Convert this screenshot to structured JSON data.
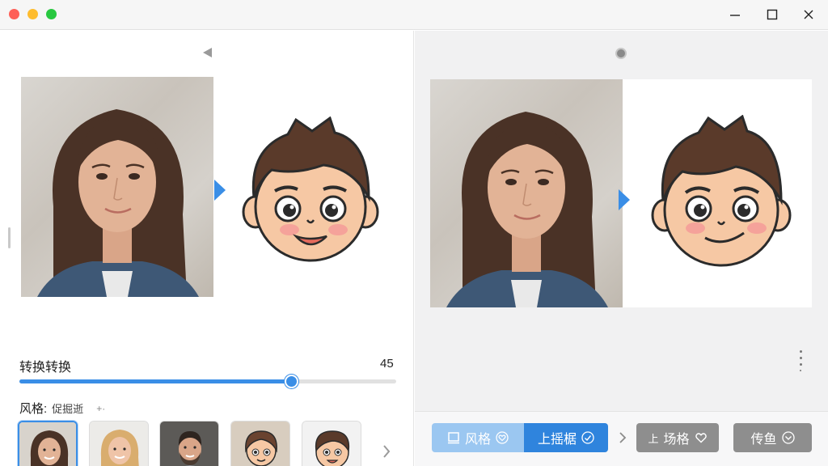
{
  "window": {
    "controls": [
      "traffic-close",
      "traffic-minimize",
      "traffic-zoom",
      "minimize",
      "maximize",
      "close"
    ]
  },
  "left_panel": {
    "slider": {
      "label": "转换转换",
      "value": "45",
      "value_fraction": 0.72
    },
    "style": {
      "label": "风格:",
      "hint": "促掘逝",
      "add_icon": "+·"
    },
    "thumbnails": [
      {
        "name": "portrait-woman-dark-hair",
        "selected": true
      },
      {
        "name": "portrait-woman-blonde",
        "selected": false
      },
      {
        "name": "portrait-man-beard",
        "selected": false
      },
      {
        "name": "cartoon-girl",
        "selected": false
      },
      {
        "name": "cartoon-boy",
        "selected": false
      }
    ]
  },
  "right_panel": {
    "buttons": {
      "style": "风格",
      "upload": "上摇椐",
      "scene": "场格",
      "scene_prefix": "上",
      "share": "传鱼"
    }
  },
  "colors": {
    "accent": "#3a8ee6",
    "accent_light": "#9bc7f1",
    "button_gray": "#8e8e8e"
  }
}
